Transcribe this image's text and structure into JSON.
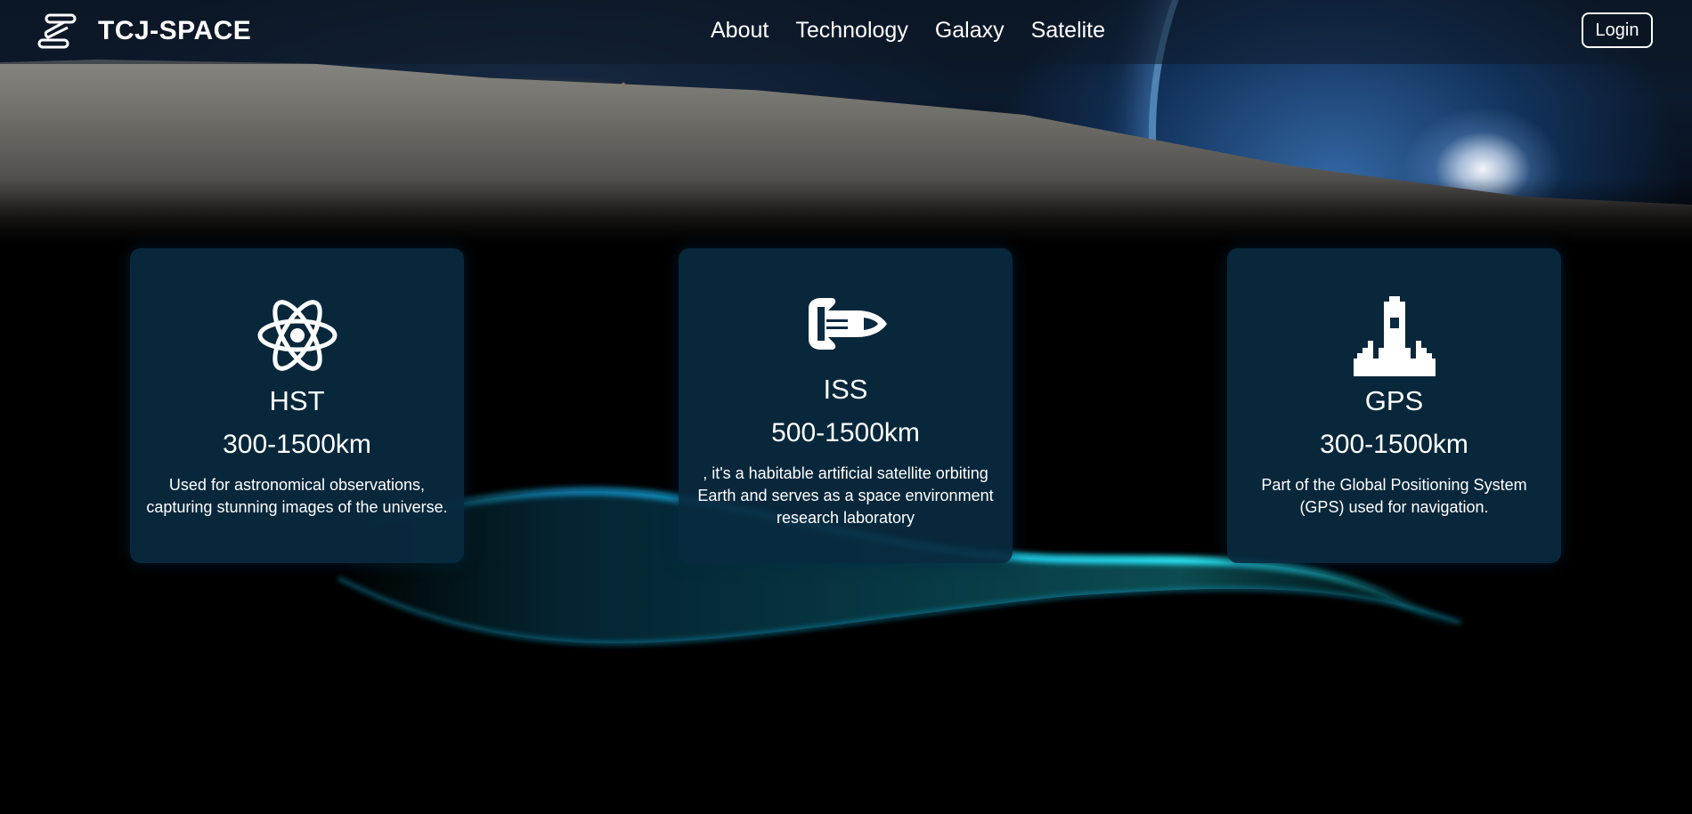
{
  "header": {
    "brand": "TCJ-SPACE",
    "nav": [
      {
        "label": "About"
      },
      {
        "label": "Technology"
      },
      {
        "label": "Galaxy"
      },
      {
        "label": "Satelite"
      }
    ],
    "login_label": "Login"
  },
  "cards": [
    {
      "icon": "atom-icon",
      "title": "HST",
      "range": "300-1500km",
      "description": "Used for astronomical observations, capturing stunning images of the universe."
    },
    {
      "icon": "space-shuttle-icon",
      "title": "ISS",
      "range": "500-1500km",
      "description": ", it's a habitable artificial satellite orbiting Earth and serves as a space environment research laboratory"
    },
    {
      "icon": "rocket-launch-icon",
      "title": "GPS",
      "range": "300-1500km",
      "description": "Part of the Global Positioning System (GPS) used for navigation."
    }
  ],
  "colors": {
    "card_background": "#092a40",
    "wave_accent": "#19e6ff",
    "page_background": "#000000"
  }
}
